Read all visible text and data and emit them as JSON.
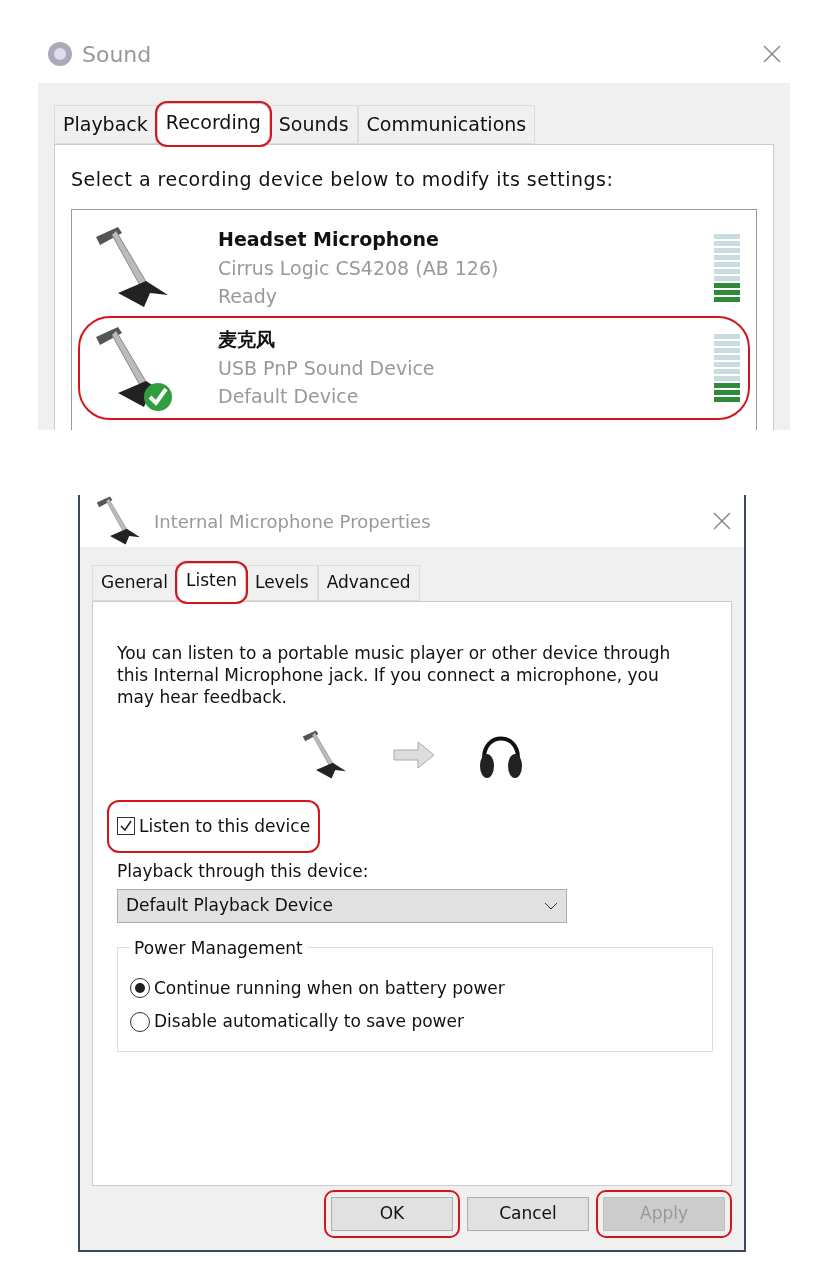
{
  "sound_window": {
    "title": "Sound",
    "tabs": [
      {
        "label": "Playback",
        "selected": false,
        "highlighted": false
      },
      {
        "label": "Recording",
        "selected": true,
        "highlighted": true
      },
      {
        "label": "Sounds",
        "selected": false,
        "highlighted": false
      },
      {
        "label": "Communications",
        "selected": false,
        "highlighted": false
      }
    ],
    "instruction": "Select a recording device below to modify its settings:",
    "devices": [
      {
        "name": "Headset Microphone",
        "driver": "Cirrus Logic CS4208 (AB 126)",
        "status": "Ready",
        "default": false,
        "highlighted": false,
        "level": 0.3
      },
      {
        "name": "麦克风",
        "driver": "USB PnP Sound Device",
        "status": "Default Device",
        "default": true,
        "highlighted": true,
        "level": 0.3
      }
    ]
  },
  "properties_window": {
    "title": "Internal Microphone Properties",
    "tabs": [
      {
        "label": "General",
        "selected": false,
        "highlighted": false
      },
      {
        "label": "Listen",
        "selected": true,
        "highlighted": true
      },
      {
        "label": "Levels",
        "selected": false,
        "highlighted": false
      },
      {
        "label": "Advanced",
        "selected": false,
        "highlighted": false
      }
    ],
    "description": "You can listen to a portable music player or other device through this Internal Microphone jack.  If you connect a microphone, you may hear feedback.",
    "listen_checkbox": {
      "label": "Listen to this device",
      "checked": true,
      "highlighted": true
    },
    "playback_label": "Playback through this device:",
    "playback_dropdown": {
      "value": "Default Playback Device"
    },
    "power_group": {
      "title": "Power Management",
      "options": [
        {
          "label": "Continue running when on battery power",
          "selected": true
        },
        {
          "label": "Disable automatically to save power",
          "selected": false
        }
      ]
    },
    "buttons": [
      {
        "label": "OK",
        "disabled": false,
        "highlighted": true
      },
      {
        "label": "Cancel",
        "disabled": false,
        "highlighted": false
      },
      {
        "label": "Apply",
        "disabled": true,
        "highlighted": true
      }
    ]
  }
}
